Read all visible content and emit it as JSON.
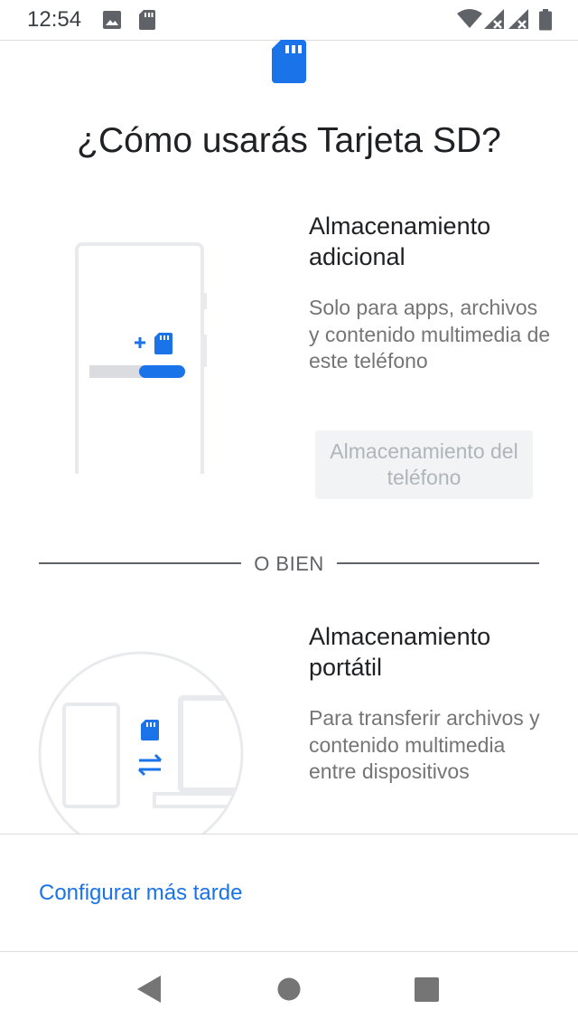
{
  "status_bar": {
    "time": "12:54",
    "left_icons": [
      "image-icon",
      "sd-card-icon"
    ],
    "right_icons": [
      "wifi-icon",
      "signal-no-data-icon",
      "signal-no-data-icon",
      "battery-icon"
    ]
  },
  "header": {
    "icon": "sd-card-icon",
    "title": "¿Cómo usarás Tarjeta SD?"
  },
  "option_internal": {
    "title": "Almacenamiento adicional",
    "description": "Solo para apps, archivos y contenido multimedia de este teléfono",
    "button_label": "Almacenamiento del teléfono"
  },
  "divider": {
    "label": "O BIEN"
  },
  "option_portable": {
    "title": "Almacenamiento portátil",
    "description": "Para transferir archivos y contenido multimedia entre dispositivos"
  },
  "footer": {
    "setup_later_label": "Configurar más tarde"
  },
  "nav_bar": {
    "buttons": [
      "back-icon",
      "home-icon",
      "recents-icon"
    ]
  },
  "colors": {
    "accent": "#1a73e8",
    "illustration_outline": "#e8eaed"
  }
}
